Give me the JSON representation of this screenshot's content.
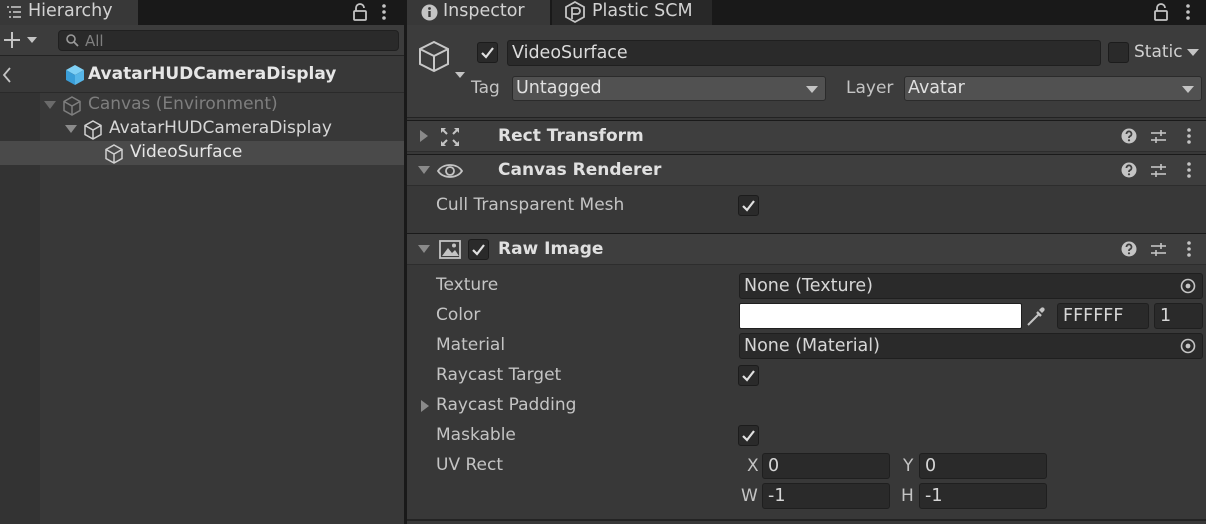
{
  "hierarchy": {
    "tab_label": "Hierarchy",
    "search_placeholder": "All",
    "scene_name": "AvatarHUDCameraDisplay",
    "tree": [
      {
        "label": "Canvas (Environment)",
        "state": "disabled"
      },
      {
        "label": "AvatarHUDCameraDisplay",
        "state": "normal"
      },
      {
        "label": "VideoSurface",
        "state": "selected"
      }
    ]
  },
  "inspector": {
    "tabs": [
      {
        "label": "Inspector"
      },
      {
        "label": "Plastic SCM"
      }
    ],
    "object": {
      "name": "VideoSurface",
      "active": true,
      "static_label": "Static",
      "tag_label": "Tag",
      "tag_value": "Untagged",
      "layer_label": "Layer",
      "layer_value": "Avatar"
    },
    "components": {
      "rect_transform": {
        "title": "Rect Transform"
      },
      "canvas_renderer": {
        "title": "Canvas Renderer",
        "cull_label": "Cull Transparent Mesh",
        "cull_value": true
      },
      "raw_image": {
        "title": "Raw Image",
        "enabled": true,
        "texture_label": "Texture",
        "texture_value": "None (Texture)",
        "color_label": "Color",
        "color_swatch": "#FFFFFF",
        "color_hex": "FFFFFF",
        "color_alpha": "1",
        "material_label": "Material",
        "material_value": "None (Material)",
        "raycast_target_label": "Raycast Target",
        "raycast_target_value": true,
        "raycast_padding_label": "Raycast Padding",
        "maskable_label": "Maskable",
        "maskable_value": true,
        "uv_rect_label": "UV Rect",
        "uv": {
          "x_label": "X",
          "x": "0",
          "y_label": "Y",
          "y": "0",
          "w_label": "W",
          "w": "-1",
          "h_label": "H",
          "h": "-1"
        }
      }
    }
  },
  "colors": {
    "panel_bg": "#383838",
    "field_bg": "#2a2a2a",
    "tab_bar": "#191919",
    "selection": "#4a4a4a",
    "cube_accent": "#4fb3e8"
  }
}
